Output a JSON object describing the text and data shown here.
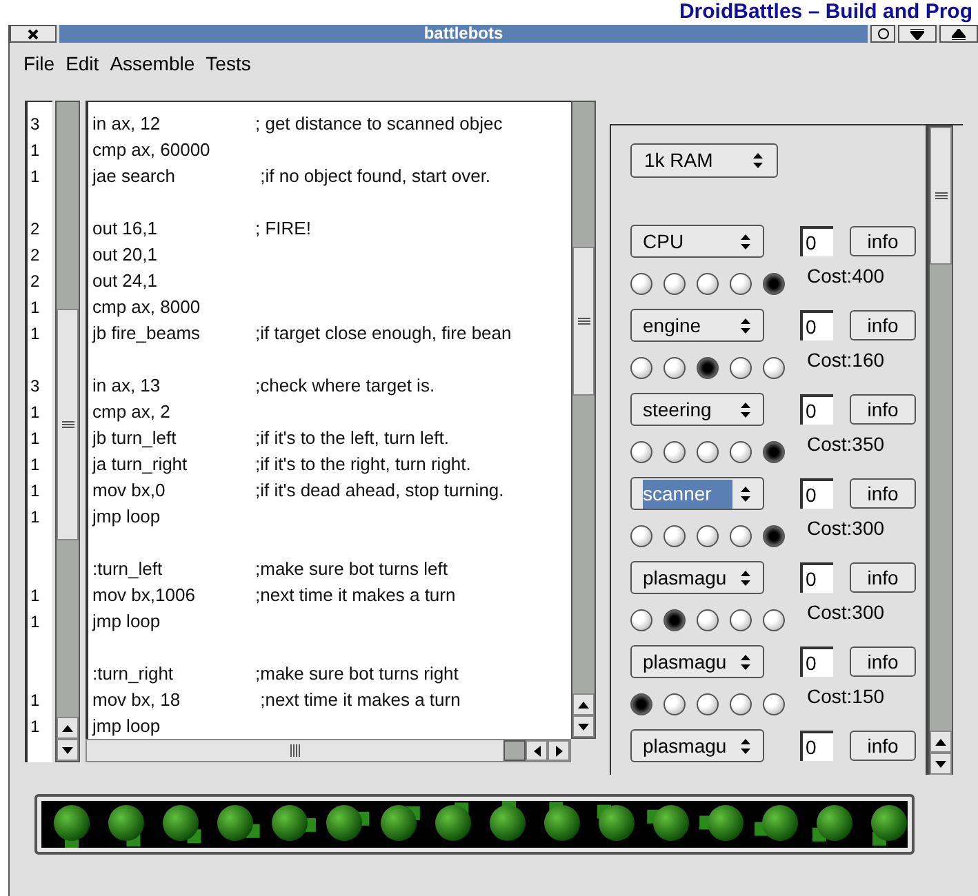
{
  "background_title": "DroidBattles – Build and Prog",
  "window": {
    "title": "battlebots"
  },
  "menu": [
    {
      "label": "File"
    },
    {
      "label": "Edit"
    },
    {
      "label": "Assemble"
    },
    {
      "label": "Tests"
    }
  ],
  "code": [
    {
      "instr": "in ax, 12",
      "comment": "; get distance to scanned objec",
      "count": "3"
    },
    {
      "instr": "cmp ax, 60000",
      "count": "1"
    },
    {
      "instr": "jae search",
      "comment": " ;if no object found, start over.",
      "count": "1"
    },
    {
      "instr": "out 16,1",
      "comment": "; FIRE!",
      "count": "2",
      "blank_line_before": true
    },
    {
      "instr": "out 20,1",
      "count": "2"
    },
    {
      "instr": "out 24,1",
      "count": "2"
    },
    {
      "instr": "cmp ax, 8000",
      "count": "1"
    },
    {
      "instr": "jb fire_beams",
      "comment": ";if target close enough, fire bean",
      "count": "1"
    },
    {
      "instr": "in ax, 13",
      "comment": ";check where target is.",
      "count": "3",
      "blank_line_before": true
    },
    {
      "instr": "cmp ax, 2",
      "count": "1"
    },
    {
      "instr": "jb turn_left",
      "comment": ";if it's to the left, turn left.",
      "count": "1"
    },
    {
      "instr": "ja turn_right",
      "comment": ";if it's to the right, turn right.",
      "count": "1"
    },
    {
      "instr": "mov bx,0",
      "comment": ";if it's dead ahead, stop turning.",
      "count": "1"
    },
    {
      "instr": "jmp loop",
      "count": "1"
    },
    {
      "instr": ":turn_left",
      "comment": ";make sure bot turns left",
      "blank_line_before": true
    },
    {
      "instr": "mov bx,1006",
      "comment": ";next time it makes a turn",
      "count": "1"
    },
    {
      "instr": "jmp loop",
      "count": "1"
    },
    {
      "instr": ":turn_right",
      "comment": ";make sure bot turns right",
      "blank_line_before": true
    },
    {
      "instr": "mov bx, 18",
      "comment": " ;next time it makes a turn",
      "count": "1"
    },
    {
      "instr": "jmp loop",
      "count": "1"
    }
  ],
  "ram_select": {
    "value": "1k RAM"
  },
  "devices": [
    {
      "device": "CPU",
      "amount": "0",
      "button": "info",
      "highlighted": false,
      "cost": "Cost:400",
      "radios": [
        {
          "selected": false
        },
        {
          "selected": false
        },
        {
          "selected": false
        },
        {
          "selected": false
        },
        {
          "selected": true
        }
      ]
    },
    {
      "device": "engine",
      "amount": "0",
      "button": "info",
      "highlighted": false,
      "cost": "Cost:160",
      "radios": [
        {
          "selected": false
        },
        {
          "selected": false
        },
        {
          "selected": true
        },
        {
          "selected": false
        },
        {
          "selected": false
        }
      ]
    },
    {
      "device": "steering",
      "amount": "0",
      "button": "info",
      "highlighted": false,
      "cost": "Cost:350",
      "radios": [
        {
          "selected": false
        },
        {
          "selected": false
        },
        {
          "selected": false
        },
        {
          "selected": false
        },
        {
          "selected": true
        }
      ]
    },
    {
      "device": "scanner",
      "amount": "0",
      "button": "info",
      "highlighted": true,
      "cost": "Cost:300",
      "radios": [
        {
          "selected": false
        },
        {
          "selected": false
        },
        {
          "selected": false
        },
        {
          "selected": false
        },
        {
          "selected": true
        }
      ]
    },
    {
      "device": "plasmagu",
      "amount": "0",
      "button": "info",
      "highlighted": false,
      "cost": "Cost:300",
      "radios": [
        {
          "selected": false
        },
        {
          "selected": true
        },
        {
          "selected": false
        },
        {
          "selected": false
        },
        {
          "selected": false
        }
      ]
    },
    {
      "device": "plasmagu",
      "amount": "0",
      "button": "info",
      "highlighted": false,
      "cost": "Cost:150",
      "radios": [
        {
          "selected": true
        },
        {
          "selected": false
        },
        {
          "selected": false
        },
        {
          "selected": false
        },
        {
          "selected": false
        }
      ]
    },
    {
      "device": "plasmagu",
      "amount": "0",
      "button": "info",
      "highlighted": false
    }
  ]
}
